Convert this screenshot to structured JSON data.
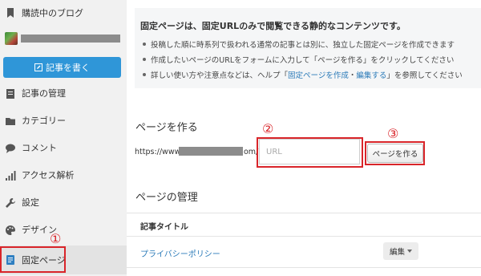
{
  "sidebar": {
    "reading_blogs": "購読中のブログ",
    "write_button": "記事を書く",
    "items": [
      {
        "label": "記事の管理",
        "icon": "document-icon"
      },
      {
        "label": "カテゴリー",
        "icon": "folder-icon"
      },
      {
        "label": "コメント",
        "icon": "comment-icon"
      },
      {
        "label": "アクセス解析",
        "icon": "chart-icon"
      },
      {
        "label": "設定",
        "icon": "wrench-icon"
      },
      {
        "label": "デザイン",
        "icon": "palette-icon"
      },
      {
        "label": "固定ページ",
        "icon": "page-icon"
      }
    ]
  },
  "info": {
    "title": "固定ページは、固定URLのみで閲覧できる静的なコンテンツです。",
    "line1": "投稿した順に時系列で扱われる通常の記事とは別に、独立した固定ページを作成できます",
    "line2": "作成したいページのURLをフォームに入力して「ページを作る」をクリックしてください",
    "line3_prefix": "詳しい使い方や注意点などは、ヘルプ「",
    "line3_link1": "固定ページを作成",
    "line3_sep": "・",
    "line3_link2": "編集する",
    "line3_suffix": "」を参照してください"
  },
  "create": {
    "heading": "ページを作る",
    "url_prefix": "https://www.",
    "url_suffix": "om/",
    "input_placeholder": "URL",
    "button_label": "ページを作る"
  },
  "manage": {
    "heading": "ページの管理",
    "column_title": "記事タイトル",
    "rows": [
      {
        "title": "プライバシーポリシー",
        "action": "編集"
      }
    ]
  },
  "annotations": {
    "one": "①",
    "two": "②",
    "three": "③"
  },
  "colors": {
    "accent": "#2f96d8",
    "annotation": "#d9252a",
    "link": "#2a7ab8"
  }
}
